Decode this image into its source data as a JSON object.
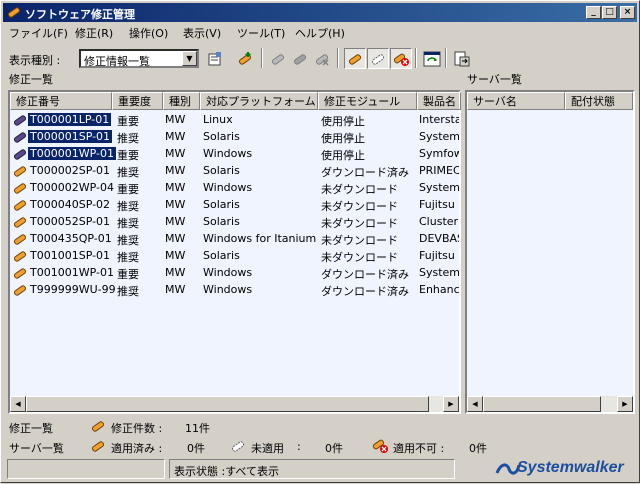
{
  "window": {
    "title": "ソフトウェア修正管理",
    "minimize_glyph": "_",
    "maximize_glyph": "□",
    "close_glyph": "×"
  },
  "menu": [
    "ファイル(F)",
    "修正(R)",
    "操作(O)",
    "表示(V)",
    "ツール(T)",
    "ヘルプ(H)"
  ],
  "toolbar": {
    "display_type_label": "表示種別 :",
    "display_type_value": "修正情報一覧",
    "icons": [
      "properties-icon",
      "add-patch-icon",
      "apply-icon",
      "stop-icon",
      "delete-icon",
      "applied-filter-icon",
      "unapplied-filter-icon",
      "not-applicable-filter-icon",
      "refresh-icon",
      "export-icon"
    ]
  },
  "fix_list": {
    "title": "修正一覧",
    "columns": [
      "修正番号",
      "重要度",
      "種別",
      "対応プラットフォーム",
      "修正モジュール",
      "製品名"
    ],
    "rows": [
      {
        "id": "T000001LP-01",
        "importance": "重要",
        "type": "MW",
        "platform": "Linux",
        "module": "使用停止",
        "product": "Interstage",
        "selected": true,
        "icon": "purple"
      },
      {
        "id": "T000001SP-01",
        "importance": "推奨",
        "type": "MW",
        "platform": "Solaris",
        "module": "使用停止",
        "product": "Systemwalker",
        "selected": true,
        "icon": "purple"
      },
      {
        "id": "T000001WP-01",
        "importance": "重要",
        "type": "MW",
        "platform": "Windows",
        "module": "使用停止",
        "product": "Symfoware",
        "selected": true,
        "icon": "purple"
      },
      {
        "id": "T000002SP-01",
        "importance": "推奨",
        "type": "MW",
        "platform": "Solaris",
        "module": "ダウンロード済み",
        "product": "PRIMECLUSTER",
        "selected": false,
        "icon": "orange"
      },
      {
        "id": "T000002WP-04",
        "importance": "重要",
        "type": "MW",
        "platform": "Windows",
        "module": "未ダウンロード",
        "product": "Systemwalker",
        "selected": false,
        "icon": "orange"
      },
      {
        "id": "T000040SP-02",
        "importance": "推奨",
        "type": "MW",
        "platform": "Solaris",
        "module": "未ダウンロード",
        "product": "Fujitsu C",
        "selected": false,
        "icon": "orange"
      },
      {
        "id": "T000052SP-01",
        "importance": "推奨",
        "type": "MW",
        "platform": "Solaris",
        "module": "未ダウンロード",
        "product": "Cluster",
        "selected": false,
        "icon": "orange"
      },
      {
        "id": "T000435QP-01",
        "importance": "推奨",
        "type": "MW",
        "platform": "Windows for Itanium",
        "module": "未ダウンロード",
        "product": "DEVBAS",
        "selected": false,
        "icon": "orange"
      },
      {
        "id": "T001001SP-01",
        "importance": "推奨",
        "type": "MW",
        "platform": "Solaris",
        "module": "未ダウンロード",
        "product": "Fujitsu C",
        "selected": false,
        "icon": "orange"
      },
      {
        "id": "T001001WP-01",
        "importance": "重要",
        "type": "MW",
        "platform": "Windows",
        "module": "ダウンロード済み",
        "product": "SystemW",
        "selected": false,
        "icon": "orange"
      },
      {
        "id": "T999999WU-99",
        "importance": "推奨",
        "type": "MW",
        "platform": "Windows",
        "module": "ダウンロード済み",
        "product": "Enhance",
        "selected": false,
        "icon": "orange"
      }
    ]
  },
  "server_list": {
    "title": "サーバ一覧",
    "columns": [
      "サーバ名",
      "配付状態"
    ]
  },
  "summary": {
    "fix_label": "修正一覧",
    "fix_count_label": "修正件数 :",
    "fix_count": "11件",
    "server_label": "サーバ一覧",
    "applied_label": "適用済み :",
    "applied_count": "0件",
    "unapplied_label": "未適用",
    "unapplied_sep": ":",
    "unapplied_count": "0件",
    "na_label": "適用不可 :",
    "na_count": "0件"
  },
  "status": {
    "text": "表示状態 :すべて表示"
  },
  "logo_text": "Systemwalker",
  "colors": {
    "title_start": "#0a246a",
    "title_end": "#3a6ea5",
    "selection": "#0a246a",
    "list_bg": "#f0f4ff",
    "logo_blue": "#1c4fa0"
  }
}
